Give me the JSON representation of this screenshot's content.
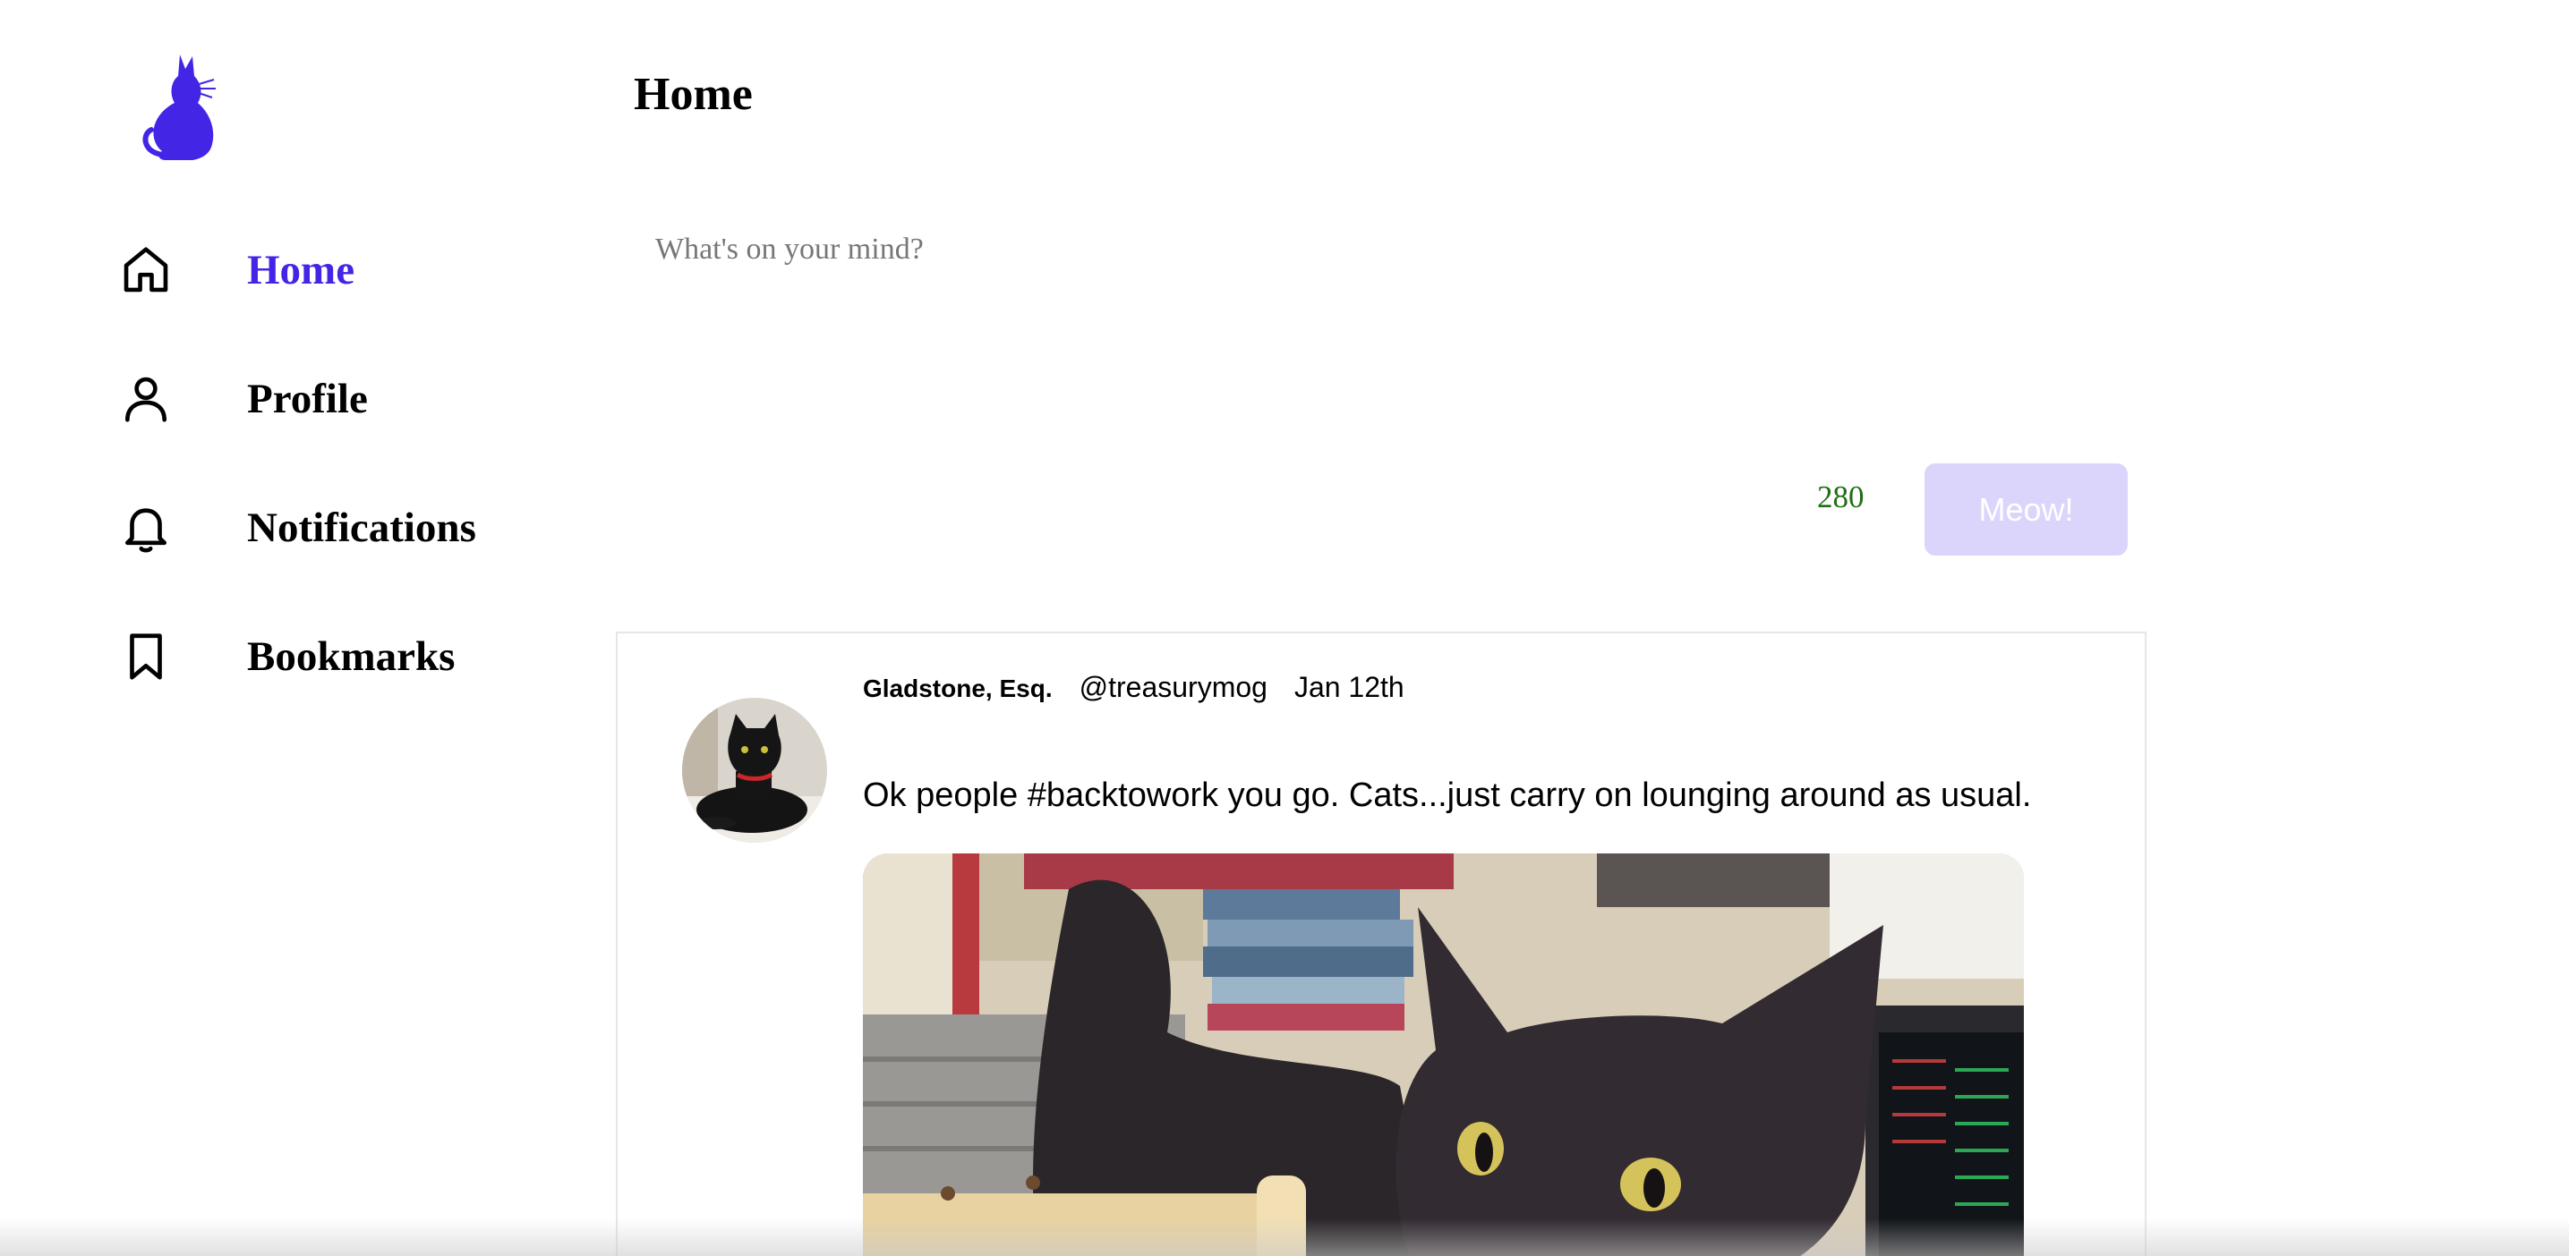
{
  "app": {
    "logo_icon": "cat-icon",
    "accent_color": "#4325e6"
  },
  "nav": {
    "items": [
      {
        "label": "Home",
        "icon": "home-icon",
        "active": true
      },
      {
        "label": "Profile",
        "icon": "user-icon",
        "active": false
      },
      {
        "label": "Notifications",
        "icon": "bell-icon",
        "active": false
      },
      {
        "label": "Bookmarks",
        "icon": "bookmark-icon",
        "active": false
      }
    ]
  },
  "main": {
    "title": "Home",
    "composer": {
      "placeholder": "What's on your mind?",
      "value": "",
      "char_count": "280",
      "submit_label": "Meow!"
    },
    "feed": [
      {
        "author_name": "Gladstone, Esq.",
        "author_handle": "@treasurymog",
        "date": "Jan 12th",
        "text": "Ok people #backtowork you go. Cats...just carry on lounging around as usual.",
        "image": "black cat on office desk"
      }
    ]
  }
}
